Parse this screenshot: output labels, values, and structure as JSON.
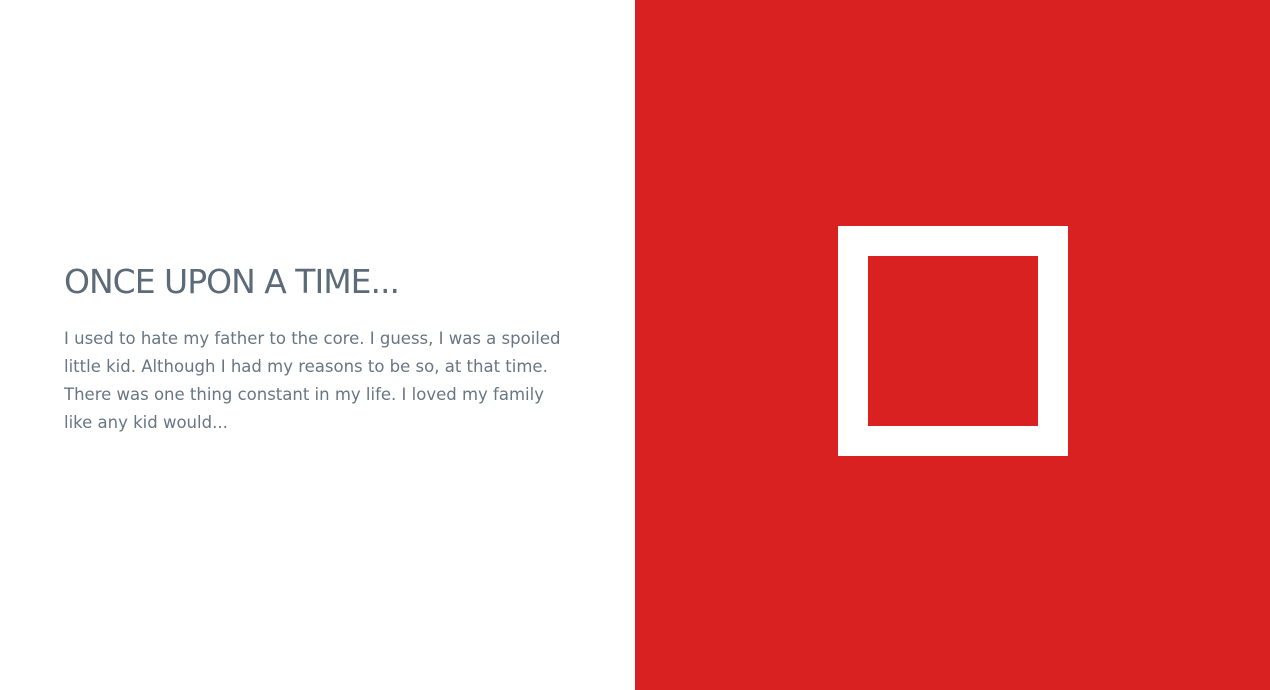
{
  "story": {
    "title": "ONCE UPON A TIME...",
    "body": "I used to hate my father to the core. I guess, I was a spoiled little kid. Although I had my reasons to be so, at that time. There was one thing constant in my life. I loved my family like any kid would..."
  },
  "colors": {
    "accent": "#d92121",
    "text": "#5d6b78",
    "background": "#ffffff"
  }
}
